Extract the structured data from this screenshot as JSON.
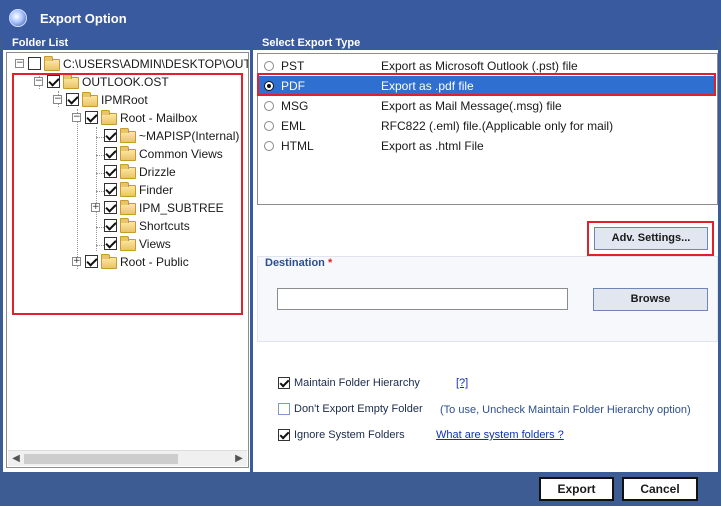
{
  "window": {
    "title": "Export Option",
    "icon": "app-globe-icon"
  },
  "folder_list": {
    "label": "Folder List",
    "nodes": [
      {
        "label": "C:\\USERS\\ADMIN\\DESKTOP\\OUTLOOK.OST",
        "checked": false
      },
      {
        "label": "OUTLOOK.OST",
        "checked": true
      },
      {
        "label": "IPMRoot",
        "checked": true
      },
      {
        "label": "Root - Mailbox",
        "checked": true
      },
      {
        "label": "~MAPISP(Internal)",
        "checked": true
      },
      {
        "label": "Common Views",
        "checked": true
      },
      {
        "label": "Drizzle",
        "checked": true
      },
      {
        "label": "Finder",
        "checked": true
      },
      {
        "label": "IPM_SUBTREE",
        "checked": true
      },
      {
        "label": "Shortcuts",
        "checked": true
      },
      {
        "label": "Views",
        "checked": true
      },
      {
        "label": "Root - Public",
        "checked": true
      }
    ]
  },
  "export_type": {
    "label": "Select Export Type",
    "selected": "PDF",
    "options": [
      {
        "name": "PST",
        "desc": "Export as Microsoft Outlook (.pst) file"
      },
      {
        "name": "PDF",
        "desc": "Export as .pdf file"
      },
      {
        "name": "MSG",
        "desc": "Export as Mail Message(.msg) file"
      },
      {
        "name": "EML",
        "desc": "RFC822 (.eml) file.(Applicable only for mail)"
      },
      {
        "name": "HTML",
        "desc": "Export as .html File"
      }
    ]
  },
  "adv_settings_label": "Adv. Settings...",
  "destination": {
    "label": "Destination",
    "required_mark": "*",
    "value": "",
    "browse_label": "Browse"
  },
  "options": {
    "maintain_hierarchy": {
      "label": "Maintain Folder Hierarchy",
      "checked": true,
      "help": "[?]"
    },
    "dont_export_empty": {
      "label": "Don't Export Empty Folder",
      "checked": false,
      "note": "(To use, Uncheck Maintain Folder Hierarchy option)"
    },
    "ignore_system": {
      "label": "Ignore System Folders",
      "checked": true,
      "link": "What are system folders ?"
    }
  },
  "footer": {
    "export_label": "Export",
    "cancel_label": "Cancel"
  },
  "colors": {
    "title_bar": "#3a5aa0",
    "selection": "#2f6fd0",
    "highlight_box": "#e0202a"
  }
}
